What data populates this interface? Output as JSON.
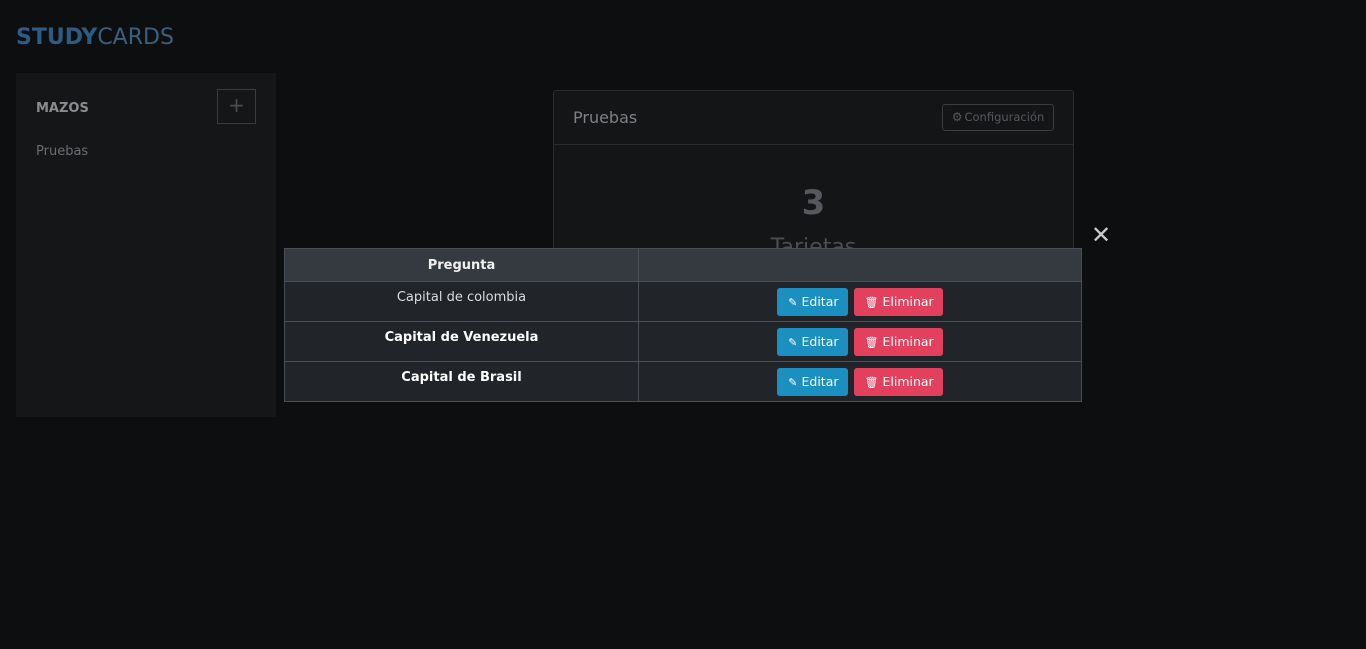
{
  "logo": {
    "part1": "STUDY",
    "part2": "CARDS"
  },
  "sidebar": {
    "title": "MAZOS",
    "add_label": "+",
    "decks": [
      {
        "label": "Pruebas"
      }
    ]
  },
  "deck_card": {
    "title": "Pruebas",
    "config_label": "Configuración",
    "count": "3",
    "count_label": "Tarjetas"
  },
  "modal": {
    "close_label": "✕",
    "table": {
      "header": {
        "question": "Pregunta",
        "actions": ""
      },
      "rows": [
        {
          "question": "Capital de colombia",
          "edit": "Editar",
          "delete": "Eliminar"
        },
        {
          "question": "Capital de Venezuela",
          "edit": "Editar",
          "delete": "Eliminar"
        },
        {
          "question": "Capital de Brasil",
          "edit": "Editar",
          "delete": "Eliminar"
        }
      ]
    }
  },
  "icons": {
    "edit": "pencil-icon",
    "delete": "trash-icon",
    "config": "gear-icon",
    "close": "close-icon",
    "add": "plus-icon"
  },
  "colors": {
    "background": "#0d0e10",
    "brand": "#2e5b82",
    "edit_button": "#1b8fc0",
    "delete_button": "#e2405d",
    "table_header": "#343a40",
    "table_body": "#212529"
  }
}
